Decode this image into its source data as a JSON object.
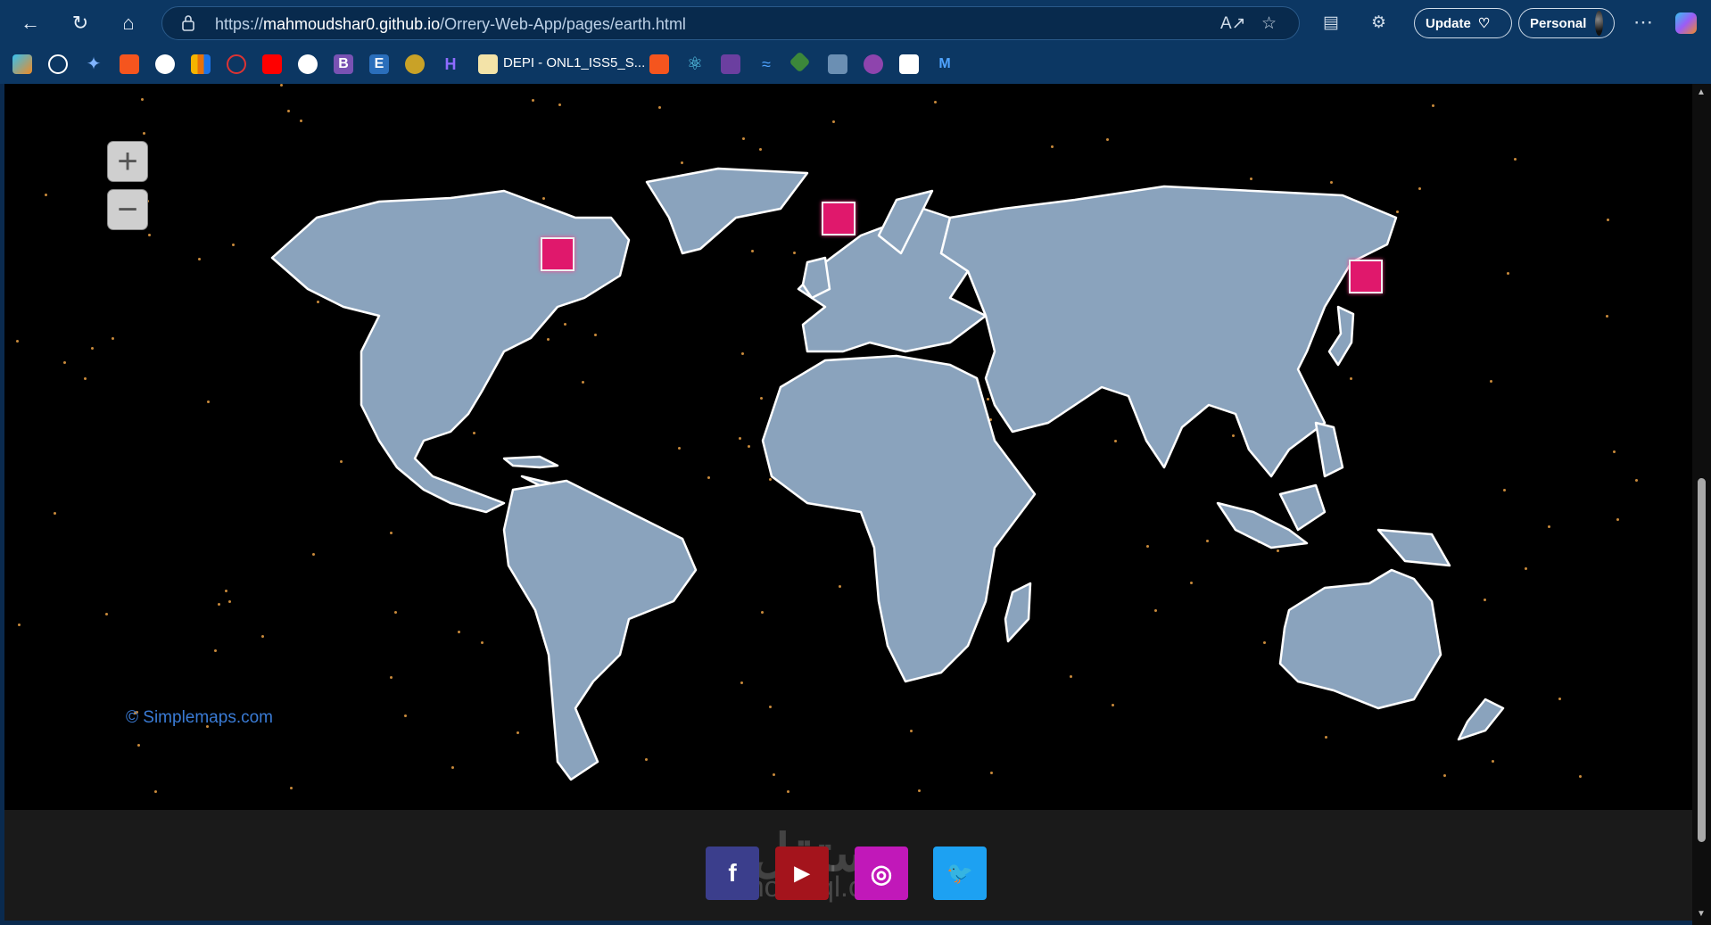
{
  "browser": {
    "url_prefix": "https://",
    "url_host": "mahmoudshar0.github.io",
    "url_path": "/Orrery-Web-App/pages/earth.html",
    "update_label": "Update",
    "profile_label": "Personal",
    "bookmark_label": "DEPI - ONL1_ISS5_S..."
  },
  "map": {
    "credit": "© Simplemaps.com",
    "land_color": "#8aa3bd",
    "marker_color": "#e0186c",
    "markers": [
      "marker-north-america",
      "marker-europe",
      "marker-japan"
    ]
  },
  "footer": {
    "watermark": "مستقل",
    "watermark_sub": "mostaql.com",
    "social": [
      {
        "icon": "facebook-icon",
        "glyph": "f",
        "color": "#3b3e8c"
      },
      {
        "icon": "youtube-icon",
        "glyph": "▶",
        "color": "#a4141c"
      },
      {
        "icon": "instagram-icon",
        "glyph": "◎",
        "color": "#c118b9"
      },
      {
        "icon": "twitter-icon",
        "glyph": "🐦",
        "color": "#1da1f2"
      }
    ]
  }
}
